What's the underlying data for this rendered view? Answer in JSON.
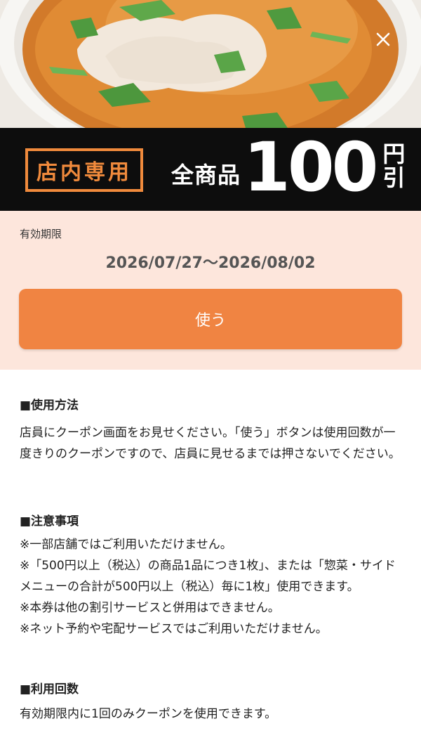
{
  "banner": {
    "badge": "店内専用",
    "offer_prefix": "全商品",
    "offer_amount": "100",
    "offer_unit_top": "円",
    "offer_unit_bottom": "引"
  },
  "validity": {
    "label": "有効期限",
    "range": "2026/07/27〜2026/08/02",
    "use_button": "使う"
  },
  "usage": {
    "title": "■使用方法",
    "body": "店員にクーポン画面をお見せください。「使う」ボタンは使用回数が一度きりのクーポンですので、店員に見せるまでは押さないでください。"
  },
  "notes": {
    "title": "■注意事項",
    "items": [
      "※一部店舗ではご利用いただけません。",
      "※「500円以上（税込）の商品1品につき1枚」、または「惣菜・サイドメニューの合計が500円以上（税込）毎に1枚」使用できます。",
      "※本券は他の割引サービスと併用はできません。",
      "※ネット予約や宅配サービスではご利用いただけません。"
    ]
  },
  "count": {
    "title": "■利用回数",
    "body": "有効期限内に1回のみクーポンを使用できます。"
  },
  "icons": {
    "close": "close-icon"
  },
  "colors": {
    "accent": "#f08442",
    "banner_bg": "#0d0d0d",
    "validity_bg": "#fde6dc"
  }
}
